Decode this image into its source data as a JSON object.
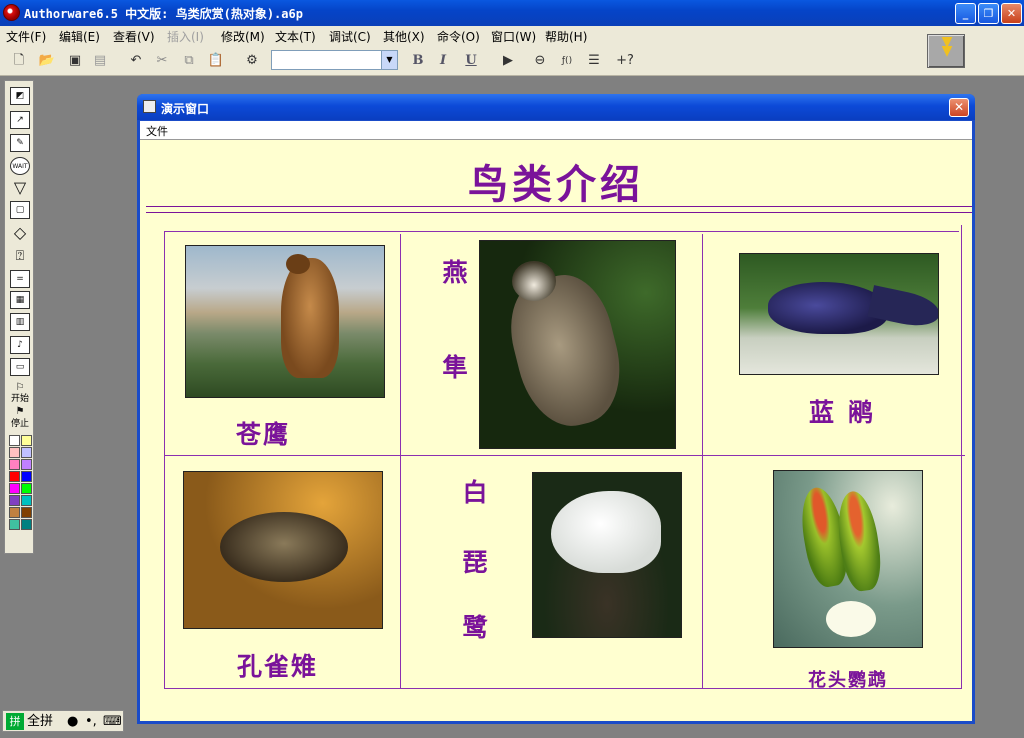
{
  "app": {
    "title": "Authorware6.5 中文版: 鸟类欣赏(热对象).a6p",
    "window_buttons": {
      "minimize": "_",
      "maximize": "❐",
      "close": "✕"
    }
  },
  "menubar": [
    {
      "id": "file",
      "label": "文件(F)"
    },
    {
      "id": "edit",
      "label": "编辑(E)"
    },
    {
      "id": "view",
      "label": "查看(V)"
    },
    {
      "id": "insert",
      "label": "插入(I)",
      "disabled": true
    },
    {
      "id": "modify",
      "label": "修改(M)"
    },
    {
      "id": "text",
      "label": "文本(T)"
    },
    {
      "id": "debug",
      "label": "调试(C)"
    },
    {
      "id": "other",
      "label": "其他(X)"
    },
    {
      "id": "command",
      "label": "命令(O)"
    },
    {
      "id": "window",
      "label": "窗口(W)"
    },
    {
      "id": "help",
      "label": "帮助(H)"
    }
  ],
  "toolbar": {
    "font_select_value": "",
    "bold": "B",
    "italic": "I",
    "underline": "U",
    "help_pointer": "+?"
  },
  "palette": {
    "start_label": "开始",
    "stop_label": "停止",
    "wait_label": "WAIT",
    "colors": [
      "#ffffff",
      "#ffff99",
      "#ffc0c0",
      "#c0c0ff",
      "#ff80c0",
      "#c080ff",
      "#ff0000",
      "#0000ff",
      "#ff00ff",
      "#00ff00",
      "#8040c0",
      "#00c0c0",
      "#c08040",
      "#804000",
      "#40c0a0",
      "#008080"
    ]
  },
  "ime": {
    "mode": "全拼",
    "dot": "●",
    "punct": "•,",
    "keyboard": "⌨"
  },
  "presentation": {
    "window_title": "演示窗口",
    "menu_file": "文件",
    "heading": "鸟类介绍",
    "birds": [
      {
        "id": "goshawk",
        "name": "苍鹰"
      },
      {
        "id": "falcon",
        "name_chars": [
          "燕",
          "隼"
        ]
      },
      {
        "id": "blue-pheasant",
        "name": "蓝鹇"
      },
      {
        "id": "peacock-pheasant",
        "name": "孔雀雉"
      },
      {
        "id": "spoonbill",
        "name_chars": [
          "白",
          "琵",
          "鹭"
        ]
      },
      {
        "id": "parakeet",
        "name": "花头鹦鹉"
      }
    ]
  }
}
